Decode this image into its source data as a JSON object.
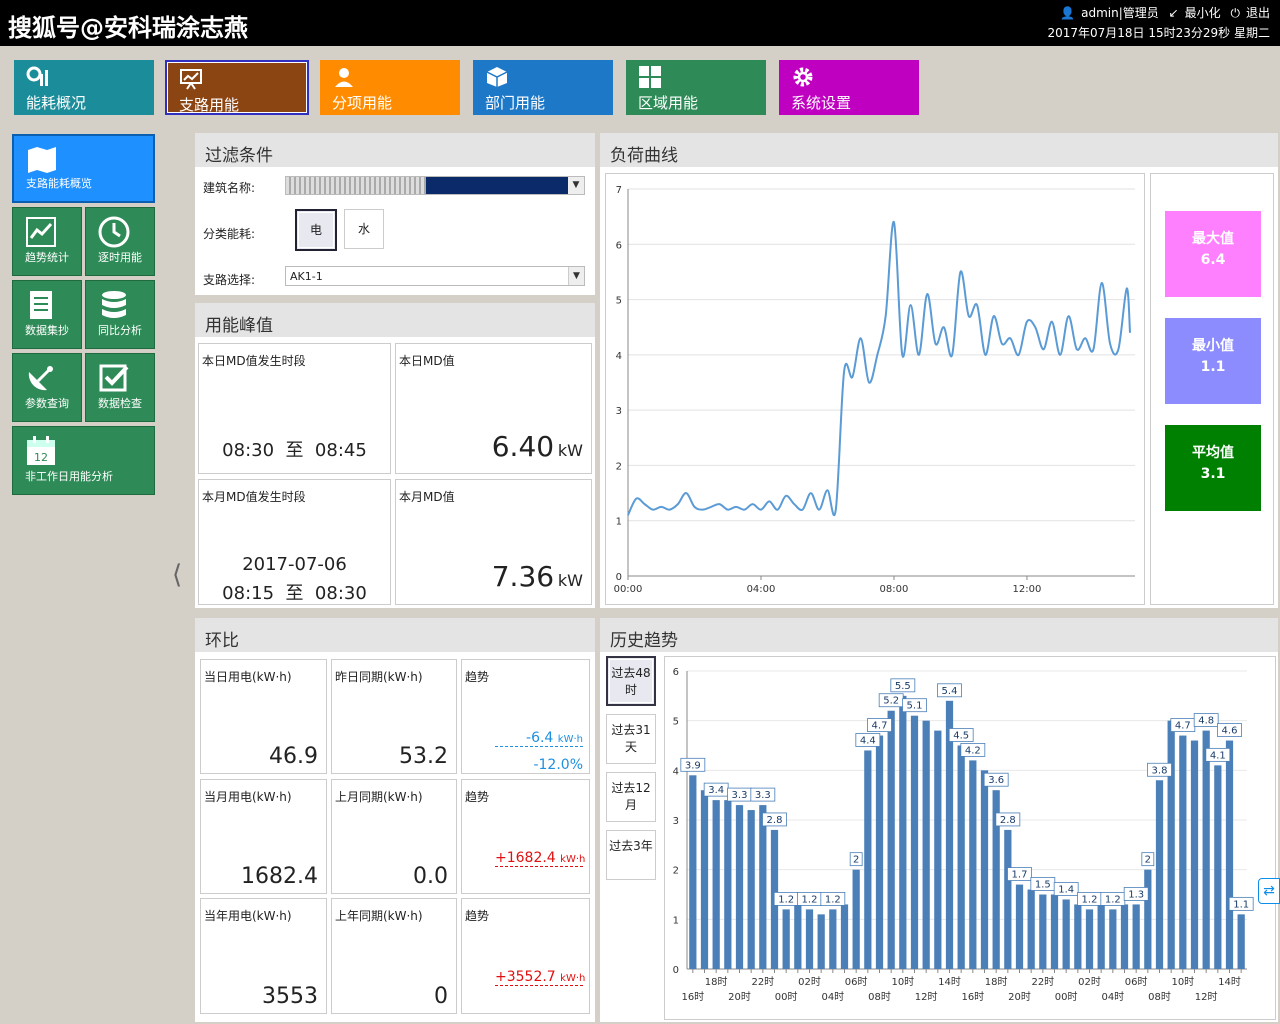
{
  "header": {
    "brand": "搜狐号@安科瑞涂志燕",
    "user": "admin|管理员",
    "minimize": "最小化",
    "logout": "退出",
    "datetime": "2017年07月18日 15时23分29秒 星期二"
  },
  "nav": [
    {
      "label": "能耗概况",
      "color": "#1a8c9a"
    },
    {
      "label": "支路用能",
      "color": "#8b4513"
    },
    {
      "label": "分项用能",
      "color": "#ff8c00"
    },
    {
      "label": "部门用能",
      "color": "#1e78c8"
    },
    {
      "label": "区域用能",
      "color": "#2e8b57"
    },
    {
      "label": "系统设置",
      "color": "#c000c0"
    }
  ],
  "sidebar": [
    "支路能耗概览",
    "趋势统计",
    "逐时用能",
    "数据集抄",
    "同比分析",
    "参数查询",
    "数据检查",
    "非工作日用能分析"
  ],
  "filter": {
    "title": "过滤条件",
    "building_label": "建筑名称:",
    "category_label": "分类能耗:",
    "elec": "电",
    "water": "水",
    "branch_label": "支路选择:",
    "branch_value": "AK1-1"
  },
  "peak": {
    "title": "用能峰值",
    "day_period_label": "本日MD值发生时段",
    "day_period": "08:30  至  08:45",
    "day_md_label": "本日MD值",
    "day_md": "6.40",
    "month_period_label": "本月MD值发生时段",
    "month_date": "2017-07-06",
    "month_period": "08:15  至  08:30",
    "month_md_label": "本月MD值",
    "month_md": "7.36",
    "unit": "kW"
  },
  "ratio": {
    "title": "环比",
    "trend_label": "趋势",
    "unit": "kW·h",
    "rows": [
      {
        "cur_label": "当日用电(kW·h)",
        "cur": "46.9",
        "prev_label": "昨日同期(kW·h)",
        "prev": "53.2",
        "delta": "-6.4",
        "pct": "-12.0%"
      },
      {
        "cur_label": "当月用电(kW·h)",
        "cur": "1682.4",
        "prev_label": "上月同期(kW·h)",
        "prev": "0.0",
        "delta": "+1682.4",
        "pct": ""
      },
      {
        "cur_label": "当年用电(kW·h)",
        "cur": "3553",
        "prev_label": "上年同期(kW·h)",
        "prev": "0",
        "delta": "+3552.7",
        "pct": ""
      }
    ]
  },
  "load": {
    "title": "负荷曲线",
    "max_label": "最大值",
    "max": "6.4",
    "min_label": "最小值",
    "min": "1.1",
    "avg_label": "平均值",
    "avg": "3.1"
  },
  "history": {
    "title": "历史趋势",
    "buttons": [
      "过去48时",
      "过去31天",
      "过去12月",
      "过去3年"
    ]
  },
  "chart_data": [
    {
      "type": "line",
      "ylim": [
        0,
        7
      ],
      "yticks": [
        0,
        1,
        2,
        3,
        4,
        5,
        6,
        7
      ],
      "xticks": [
        "00:00",
        "04:00",
        "08:00",
        "12:00"
      ],
      "xlim": [
        0,
        15.25
      ],
      "x": [
        0,
        0.25,
        0.5,
        0.75,
        1,
        1.25,
        1.5,
        1.75,
        2,
        2.25,
        2.5,
        2.75,
        3,
        3.25,
        3.5,
        3.75,
        4,
        4.25,
        4.5,
        4.75,
        5,
        5.25,
        5.5,
        5.75,
        6,
        6.25,
        6.5,
        6.75,
        7,
        7.25,
        7.5,
        7.75,
        8,
        8.25,
        8.5,
        8.75,
        9,
        9.25,
        9.5,
        9.75,
        10,
        10.25,
        10.5,
        10.75,
        11,
        11.25,
        11.5,
        11.75,
        12,
        12.25,
        12.5,
        12.75,
        13,
        13.25,
        13.5,
        13.75,
        14,
        14.25,
        14.5,
        14.75,
        15,
        15.1
      ],
      "y": [
        1.1,
        1.4,
        1.3,
        1.2,
        1.25,
        1.2,
        1.3,
        1.5,
        1.25,
        1.2,
        1.25,
        1.3,
        1.2,
        1.25,
        1.2,
        1.3,
        1.2,
        1.35,
        1.2,
        1.45,
        1.3,
        1.2,
        1.5,
        1.2,
        1.55,
        1.2,
        3.7,
        3.6,
        4.3,
        3.5,
        4.0,
        4.7,
        6.4,
        4.0,
        4.9,
        4.0,
        5.1,
        4.2,
        4.5,
        4.0,
        5.5,
        4.7,
        4.9,
        4.0,
        4.7,
        4.2,
        4.3,
        4.0,
        4.6,
        4.5,
        4.1,
        4.6,
        4.0,
        4.7,
        4.1,
        4.3,
        4.1,
        5.3,
        4.2,
        4.1,
        5.2,
        4.4
      ]
    },
    {
      "type": "bar",
      "ylim": [
        0,
        6
      ],
      "yticks": [
        0,
        1,
        2,
        3,
        4,
        5,
        6
      ],
      "xticks_top": [
        "18时",
        "22时",
        "02时",
        "06时",
        "10时",
        "14时",
        "18时",
        "22时",
        "02时",
        "06时",
        "10时",
        "14时"
      ],
      "xticks_bottom": [
        "16时",
        "20时",
        "00时",
        "04时",
        "08时",
        "12时",
        "16时",
        "20时",
        "00时",
        "04时",
        "08时",
        "12时"
      ],
      "values": [
        3.9,
        3.6,
        3.4,
        3.4,
        3.3,
        3.2,
        3.3,
        2.8,
        1.2,
        1.3,
        1.2,
        1.1,
        1.2,
        1.3,
        2.0,
        4.4,
        4.7,
        5.2,
        5.5,
        5.1,
        5.0,
        4.8,
        5.4,
        4.5,
        4.2,
        4.0,
        3.6,
        2.8,
        1.7,
        1.6,
        1.5,
        1.5,
        1.4,
        1.3,
        1.2,
        1.4,
        1.2,
        1.3,
        1.3,
        2.0,
        3.8,
        5.0,
        4.7,
        4.6,
        4.8,
        4.1,
        4.6,
        1.1
      ],
      "labeled": [
        0,
        2,
        4,
        6,
        7,
        8,
        10,
        12,
        14,
        15,
        16,
        17,
        18,
        19,
        22,
        23,
        24,
        26,
        27,
        28,
        30,
        32,
        34,
        36,
        38,
        39,
        40,
        42,
        44,
        45,
        46,
        47
      ]
    }
  ]
}
